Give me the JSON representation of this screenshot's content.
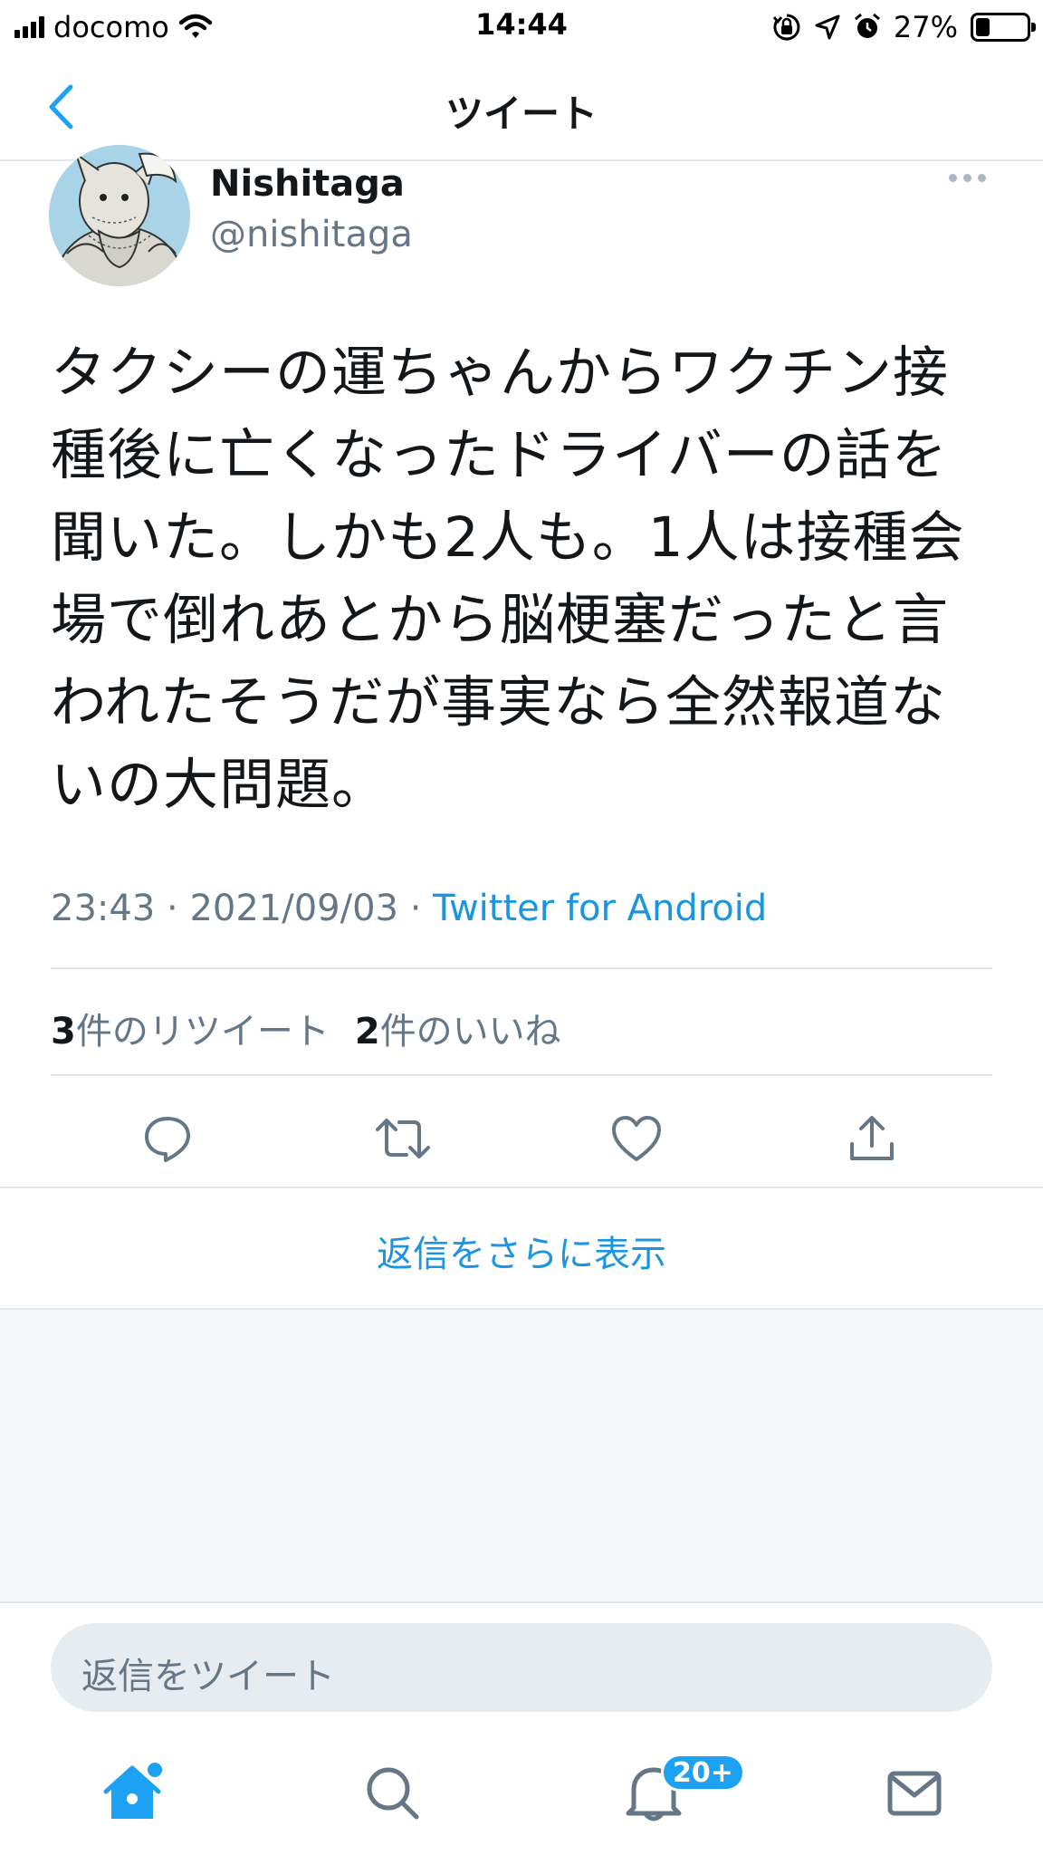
{
  "status_bar": {
    "carrier": "docomo",
    "time": "14:44",
    "battery_percent": "27%",
    "battery_level": 0.27,
    "icons": [
      "signal-icon",
      "wifi-icon",
      "orientation-lock-icon",
      "location-icon",
      "alarm-icon",
      "battery-icon"
    ]
  },
  "nav": {
    "title": "ツイート",
    "back_icon": "chevron-left-icon"
  },
  "tweet": {
    "display_name": "Nishitaga",
    "handle": "@nishitaga",
    "text_lines": [
      "タクシーの運ちゃんからワクチン接",
      "種後に亡くなったドライバーの話を",
      "聞いた。しかも2人も。1人は接種会",
      "場で倒れあとから脳梗塞だったと言",
      "われたそうだが事実なら全然報道な",
      "いの大問題。"
    ],
    "time": "23:43",
    "date": "2021/09/03",
    "separator": "·",
    "source": "Twitter for Android",
    "retweet_count": "3",
    "retweet_label": "件のリツイート",
    "like_count": "2",
    "like_label": "件のいいね"
  },
  "actions": [
    "reply-icon",
    "retweet-icon",
    "like-icon",
    "share-icon"
  ],
  "more_replies": "返信をさらに表示",
  "reply_box": {
    "placeholder": "返信をツイート"
  },
  "tab_bar": {
    "tabs": [
      "home-icon",
      "search-icon",
      "notifications-icon",
      "messages-icon"
    ],
    "notification_badge": "20+"
  },
  "colors": {
    "accent": "#1da1f2",
    "link": "#1b95e0",
    "secondary_text": "#657786",
    "divider": "#e1e8ed"
  }
}
